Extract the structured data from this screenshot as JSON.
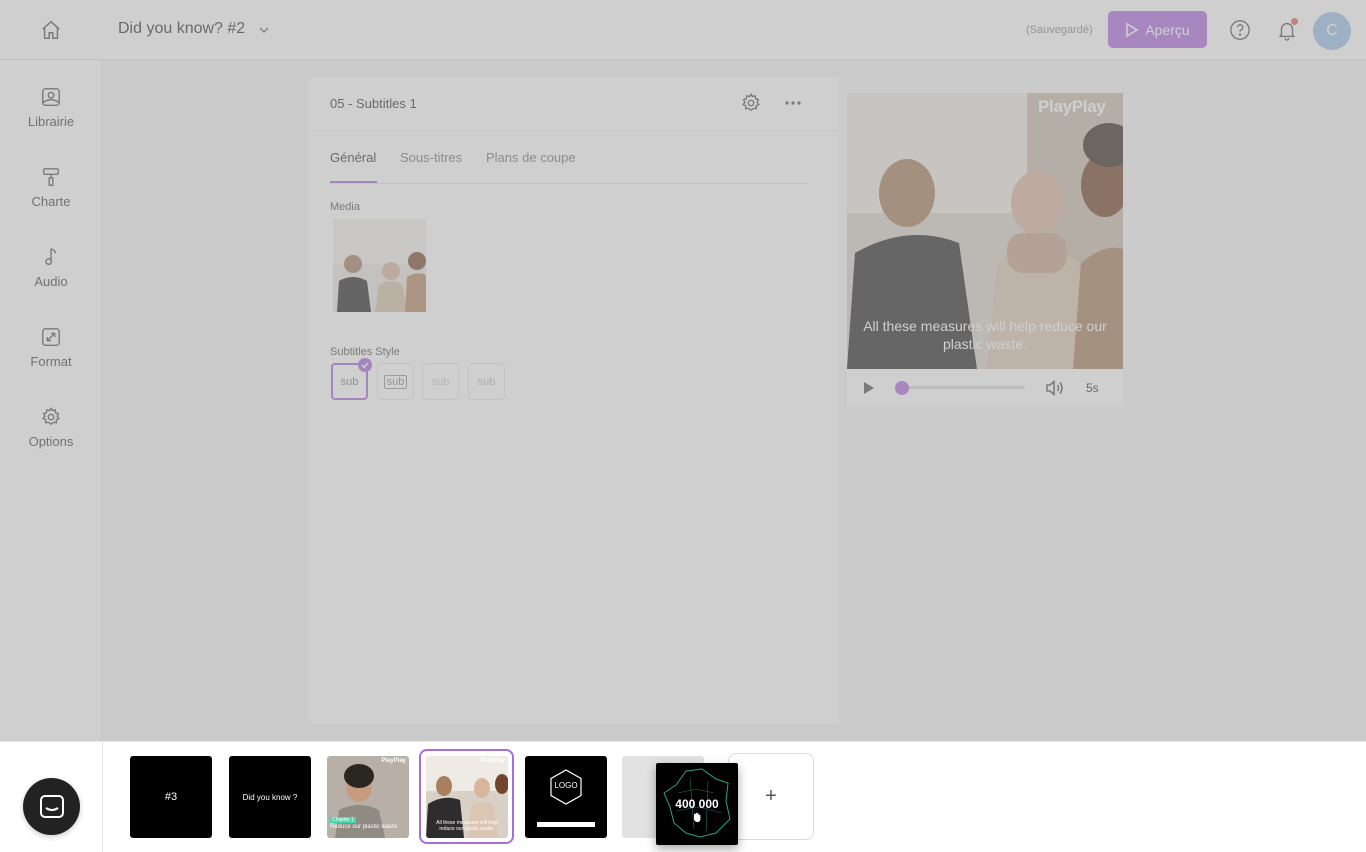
{
  "header": {
    "project_title": "Did you know? #2",
    "save_status": "(Sauvegardé)",
    "preview_label": "Aperçu",
    "avatar_initial": "C"
  },
  "sidebar": {
    "items": [
      {
        "label": "Librairie",
        "icon": "image-icon"
      },
      {
        "label": "Charte",
        "icon": "paint-roller-icon"
      },
      {
        "label": "Audio",
        "icon": "music-note-icon"
      },
      {
        "label": "Format",
        "icon": "resize-icon"
      },
      {
        "label": "Options",
        "icon": "gear-icon"
      }
    ]
  },
  "editor": {
    "scene_name": "05 - Subtitles 1",
    "tabs": [
      "Général",
      "Sous-titres",
      "Plans de coupe"
    ],
    "active_tab": "Général",
    "media_label": "Media",
    "subtitles_style_label": "Subtitles Style",
    "subtitle_styles": [
      "sub",
      "sub",
      "sub",
      "sub"
    ],
    "selected_style_index": 0
  },
  "preview": {
    "brand_logo": "PlayPlay",
    "caption": "All these measures will help reduce our plastic waste.",
    "duration": "5s",
    "progress_fraction": 0.02
  },
  "timeline": {
    "scenes": [
      {
        "text": "#3"
      },
      {
        "text": "Did you know ?"
      },
      {
        "brand": "PlayPlay",
        "tag": "Chapter 1",
        "caption": "Reduce our plastic waste"
      },
      {
        "brand": "PlayPlay",
        "caption": "All these measures will help reduce our plastic waste.",
        "selected": true
      },
      {
        "logo_text": "LOGO"
      },
      {},
      {
        "text": "400 000",
        "dragging": true
      }
    ],
    "add_label": "+"
  },
  "colors": {
    "accent": "#a86ddc",
    "preview_button": "#b16fe0",
    "avatar": "#9cc3e8",
    "notification_dot": "#e4694c"
  }
}
